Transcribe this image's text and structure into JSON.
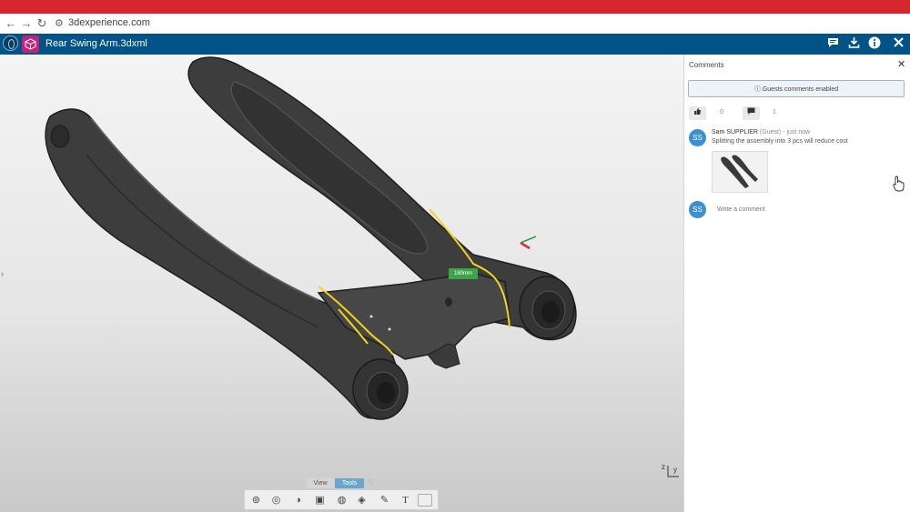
{
  "browser": {
    "url": "3dexperience.com",
    "back_glyph": "←",
    "forward_glyph": "→",
    "reload_glyph": "↻"
  },
  "app": {
    "file_name": "Rear Swing Arm.3dxml",
    "icons": [
      "compass-icon",
      "app-cube-icon",
      "comments-icon",
      "download-icon",
      "info-icon",
      "close-icon"
    ],
    "accent_color": "#005386"
  },
  "viewer": {
    "dimension_label": "180mm",
    "tabs": [
      "View",
      "Tools"
    ],
    "active_tab": "Tools",
    "axis_y": "y",
    "axis_z": "z",
    "text_tool_glyph": "T"
  },
  "comments": {
    "title": "Comments",
    "close_glyph": "✕",
    "guests_notice": "Guests comments enabled",
    "like_count": "0",
    "comment_count": "1",
    "items": [
      {
        "initials": "SS",
        "author": "Sam SUPPLIER",
        "meta": "(Guest) - just now",
        "text": "Splitting the assembly into 3 pcs will reduce cost"
      }
    ],
    "current_user_initials": "SS",
    "write_placeholder": "Write a comment"
  }
}
